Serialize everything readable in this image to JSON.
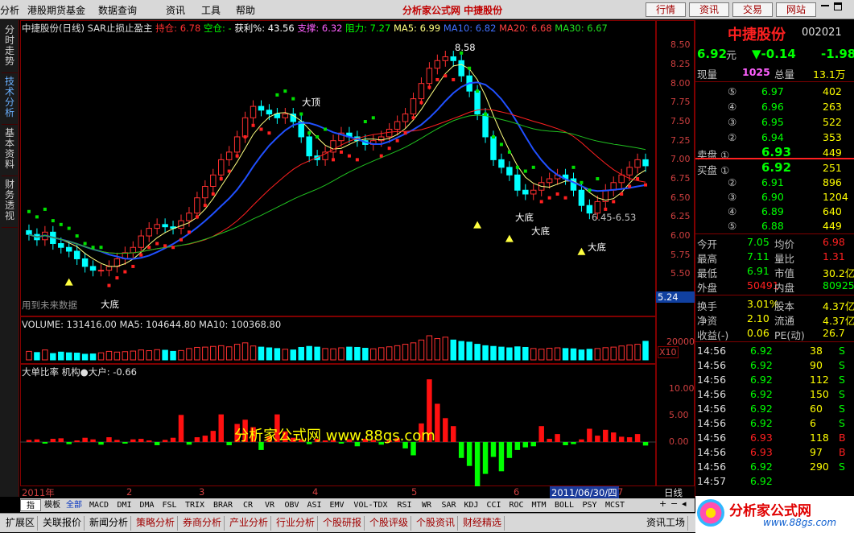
{
  "menu": {
    "items": [
      "分析",
      "港股期货基金",
      "数据查询",
      "资讯",
      "工具",
      "帮助"
    ],
    "center_title": "分析家公式网 中捷股份",
    "right_buttons": [
      "行情",
      "资讯",
      "交易",
      "网站"
    ]
  },
  "left_tabs": [
    "分时走势",
    "技术分析",
    "基本资料",
    "财务透视"
  ],
  "chart_header": {
    "name": "中捷股份(日线)",
    "indicator": "SAR止损止盈主",
    "hold_label": "持仓: 6.78",
    "empty_label": "空仓: -",
    "profit_label": "获利%: 43.56",
    "support_label": "支撑: 6.32",
    "resist_label": "阻力: 7.27",
    "ma5": "MA5: 6.99",
    "ma10": "MA10: 6.82",
    "ma20": "MA20: 6.68",
    "ma30": "MA30: 6.67"
  },
  "annotations": {
    "top_price": "8.58",
    "big_top": "大顶",
    "big_bottom": "大底",
    "range_label": "6.45-6.53",
    "watermark_text": "用到未来数据",
    "center_watermark": "分析家公式网  www.88gs.com",
    "current_price_tag": "5.24"
  },
  "volume_header": {
    "label": "VOLUME: 131416.00",
    "ma5": "MA5: 104644.80",
    "ma10": "MA10: 100368.80",
    "scale_label": "X10",
    "tick": "20000"
  },
  "indicator_header": {
    "label": "大单比率",
    "detail": "机构●大户: -0.66"
  },
  "price_axis": [
    "8.50",
    "8.25",
    "8.00",
    "7.75",
    "7.50",
    "7.25",
    "7.00",
    "6.75",
    "6.50",
    "6.25",
    "6.00",
    "5.75",
    "5.50"
  ],
  "ind_axis": [
    "10.00",
    "5.00",
    "0.00"
  ],
  "time_axis": {
    "labels": [
      "2011年",
      "2",
      "3",
      "4",
      "5",
      "6",
      "7"
    ],
    "cursor_date": "2011/06/30/四",
    "period": "日线"
  },
  "chart_data": {
    "type": "bar",
    "title": "中捷股份(日线)",
    "ylim": [
      5.24,
      8.62
    ],
    "ohlc_note": "candles approximate close prices read from axis",
    "closes": [
      6.02,
      5.95,
      6.05,
      5.9,
      5.85,
      5.8,
      5.7,
      5.6,
      5.55,
      5.55,
      5.6,
      5.7,
      5.78,
      5.85,
      6.0,
      6.1,
      6.15,
      6.12,
      6.1,
      6.2,
      6.3,
      6.5,
      6.65,
      6.8,
      7.0,
      7.1,
      7.3,
      7.55,
      7.7,
      7.65,
      7.6,
      7.55,
      7.6,
      7.5,
      7.3,
      7.05,
      7.0,
      7.1,
      7.25,
      7.35,
      7.3,
      7.25,
      7.2,
      7.25,
      7.3,
      7.4,
      7.5,
      7.6,
      7.8,
      8.0,
      8.2,
      8.3,
      8.35,
      8.3,
      8.1,
      7.9,
      7.6,
      7.3,
      7.0,
      6.9,
      6.8,
      6.6,
      6.55,
      6.6,
      6.7,
      6.75,
      6.8,
      6.75,
      6.6,
      6.4,
      6.3,
      6.45,
      6.6,
      6.7,
      6.8,
      6.9,
      7.0,
      6.92
    ],
    "volume": [
      60,
      52,
      70,
      45,
      55,
      50,
      48,
      40,
      42,
      50,
      60,
      55,
      58,
      62,
      70,
      65,
      72,
      68,
      60,
      66,
      80,
      88,
      90,
      95,
      100,
      92,
      110,
      120,
      98,
      90,
      85,
      80,
      75,
      70,
      88,
      95,
      90,
      80,
      78,
      85,
      90,
      88,
      82,
      78,
      86,
      92,
      100,
      110,
      120,
      140,
      170,
      150,
      160,
      140,
      130,
      125,
      110,
      100,
      95,
      90,
      85,
      92,
      88,
      80,
      76,
      82,
      85,
      80,
      78,
      70,
      75,
      80,
      86,
      90,
      98,
      105,
      110,
      131
    ],
    "ratio": [
      0.4,
      0.5,
      -0.3,
      0.6,
      0.7,
      -0.4,
      0.3,
      0.8,
      0.5,
      -0.5,
      0.9,
      0.4,
      -0.3,
      0.5,
      0.6,
      0.3,
      -0.6,
      0.4,
      0.8,
      5.1,
      -0.5,
      0.9,
      1.2,
      2.1,
      5.2,
      -0.6,
      3.4,
      4.2,
      2.8,
      -1.5,
      1.1,
      5.2,
      2.0,
      0.8,
      0.5,
      -0.4,
      0.6,
      0.3,
      0.4,
      -0.3,
      0.5,
      -0.8,
      0.6,
      0.4,
      -0.5,
      0.3,
      0.7,
      -1.2,
      -2.5,
      3.5,
      11.8,
      7.2,
      4.5,
      3.0,
      -3.0,
      -4.5,
      -8.5,
      -6.0,
      -2.8,
      -5.5,
      -3.0,
      -1.5,
      -1.0,
      -0.8,
      3.0,
      0.6,
      1.5,
      -0.6,
      -0.4,
      0.5,
      2.5,
      1.2,
      2.3,
      1.8,
      1.0,
      0.9,
      1.5,
      -0.66
    ]
  },
  "quote": {
    "name": "中捷股份",
    "code": "002021",
    "price": "6.92",
    "unit": "元",
    "change": "▼-0.14",
    "change_pct": "-1.98",
    "now_vol_label": "现量",
    "now_vol": "1025",
    "total_vol_label": "总量",
    "total_vol": "13.1万",
    "sell": [
      {
        "lvl": "⑤",
        "price": "6.97",
        "vol": "402"
      },
      {
        "lvl": "④",
        "price": "6.96",
        "vol": "263"
      },
      {
        "lvl": "③",
        "price": "6.95",
        "vol": "522"
      },
      {
        "lvl": "②",
        "price": "6.94",
        "vol": "353"
      },
      {
        "lvl": "卖盘 ①",
        "price": "6.93",
        "vol": "449"
      }
    ],
    "buy": [
      {
        "lvl": "买盘 ①",
        "price": "6.92",
        "vol": "251"
      },
      {
        "lvl": "②",
        "price": "6.91",
        "vol": "896"
      },
      {
        "lvl": "③",
        "price": "6.90",
        "vol": "1204"
      },
      {
        "lvl": "④",
        "price": "6.89",
        "vol": "640"
      },
      {
        "lvl": "⑤",
        "price": "6.88",
        "vol": "449"
      }
    ],
    "stats": [
      {
        "l1": "今开",
        "v1": "7.05",
        "l2": "均价",
        "v2": "6.98"
      },
      {
        "l1": "最高",
        "v1": "7.11",
        "l2": "量比",
        "v2": "1.31"
      },
      {
        "l1": "最低",
        "v1": "6.91",
        "l2": "市值",
        "v2": "30.2亿"
      },
      {
        "l1": "外盘",
        "v1": "50491",
        "l2": "内盘",
        "v2": "80925"
      }
    ],
    "stats2": [
      {
        "l1": "换手",
        "v1": "3.01%",
        "l2": "股本",
        "v2": "4.37亿"
      },
      {
        "l1": "净资",
        "v1": "2.10",
        "l2": "流通",
        "v2": "4.37亿"
      },
      {
        "l1": "收益(-)",
        "v1": "0.06",
        "l2": "PE(动)",
        "v2": "26.7"
      }
    ],
    "ticks": [
      {
        "t": "14:56",
        "p": "6.92",
        "v": "38",
        "s": "S"
      },
      {
        "t": "14:56",
        "p": "6.92",
        "v": "90",
        "s": "S"
      },
      {
        "t": "14:56",
        "p": "6.92",
        "v": "112",
        "s": "S"
      },
      {
        "t": "14:56",
        "p": "6.92",
        "v": "150",
        "s": "S"
      },
      {
        "t": "14:56",
        "p": "6.92",
        "v": "60",
        "s": "S"
      },
      {
        "t": "14:56",
        "p": "6.92",
        "v": "6",
        "s": "S"
      },
      {
        "t": "14:56",
        "p": "6.93",
        "v": "118",
        "s": "B"
      },
      {
        "t": "14:56",
        "p": "6.93",
        "v": "97",
        "s": "B"
      },
      {
        "t": "14:56",
        "p": "6.92",
        "v": "290",
        "s": "S"
      },
      {
        "t": "14:57",
        "p": "6.92",
        "v": "",
        "s": ""
      }
    ]
  },
  "indicator_buttons": [
    "指标",
    "模板",
    "全部",
    "MACD",
    "DMI",
    "DMA",
    "FSL",
    "TRIX",
    "BRAR",
    "CR",
    "VR",
    "OBV",
    "ASI",
    "EMV",
    "VOL-TDX",
    "RSI",
    "WR",
    "SAR",
    "KDJ",
    "CCI",
    "ROC",
    "MTM",
    "BOLL",
    "PSY",
    "MCST"
  ],
  "nav_buttons": [
    "扩展区",
    "关联报价",
    "新闻分析",
    "策略分析",
    "券商分析",
    "产业分析",
    "行业分析",
    "个股研报",
    "个股评级",
    "个股资讯",
    "财经精选"
  ],
  "footer": {
    "info_label": "资讯工场",
    "brand": "分析家公式网",
    "url": "www.88gs.com"
  },
  "colors": {
    "up": "#ff3030",
    "down": "#00ffff",
    "green": "#00e000",
    "ma5": "#ffff80",
    "ma10": "#2050ff",
    "ma20": "#ff2020",
    "ma30": "#20c020"
  }
}
